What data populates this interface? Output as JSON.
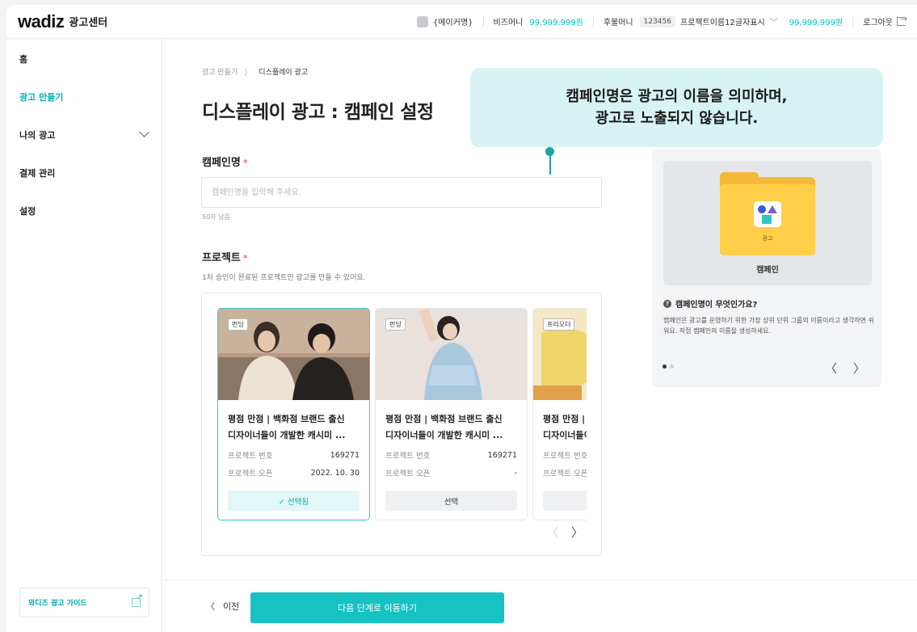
{
  "header": {
    "logo": "wadiz",
    "logo_sub": "광고센터",
    "maker_name": "{메이커명}",
    "biz_money_label": "비즈머니",
    "biz_money_value": "99,999,999원",
    "postpaid_label": "후불머니",
    "project_code": "123456",
    "project_name": "프로젝트이름12글자표시",
    "postpaid_value": "99,999,999원",
    "logout_label": "로그아웃"
  },
  "sidebar": {
    "items": [
      {
        "label": "홈"
      },
      {
        "label": "광고 만들기"
      },
      {
        "label": "나의 광고"
      },
      {
        "label": "결제 관리"
      },
      {
        "label": "설정"
      }
    ],
    "guide_label": "와디즈 광고 가이드"
  },
  "breadcrumb": {
    "parent": "광고 만들기",
    "current": "디스플레이 광고"
  },
  "page_title": "디스플레이 광고 : 캠페인 설정",
  "campaign_name": {
    "label": "캠페인명",
    "required_mark": "*",
    "placeholder": "캠페인명을 입력해 주세요.",
    "chars_left": "50자 남음"
  },
  "project": {
    "label": "프로젝트",
    "required_mark": "*",
    "description": "1차 승인이 완료된 프로젝트만 광고를 만들 수 있어요.",
    "number_label": "프로젝트 번호",
    "open_label": "프로젝트 오픈",
    "cards": [
      {
        "tag": "펀딩",
        "title_line1": "평점 만점 | 백화점 브랜드 출신",
        "title_line2": "디자이너들이 개발한 캐시미 ...",
        "number": "169271",
        "open": "2022. 10. 30",
        "button": "✓ 선택됨",
        "selected": true
      },
      {
        "tag": "펀딩",
        "title_line1": "평점 만점 | 백화점 브랜드 출신",
        "title_line2": "디자이너들이 개발한 캐시미 ...",
        "number": "169271",
        "open": "-",
        "button": "선택",
        "selected": false
      },
      {
        "tag": "프리오더",
        "title_line1": "평점 만점 | 백화점 브랜드 출신",
        "title_line2": "디자이너들이 개발한 캐시미 ...",
        "number": "",
        "open": "",
        "button": "",
        "selected": false
      }
    ]
  },
  "tooltip": {
    "line1": "캠페인명은 광고의 이름을 의미하며,",
    "line2": "광고로 노출되지 않습니다."
  },
  "tip_panel": {
    "folder_label": "광고",
    "image_caption": "캠페인",
    "question": "캠페인명이 무엇인가요?",
    "description": "캠페인은 광고를 운영하기 위한 가장 상위 단위 그룹의 이름이라고 생각하면 쉬워요. 직접 캠페인의 이름을 생성하세요."
  },
  "footer": {
    "prev_label": "이전",
    "next_label": "다음 단계로 이동하기"
  },
  "colors": {
    "accent": "#16c2c2",
    "money": "#00c4c4",
    "tooltip_bg": "#d8f3f3",
    "required": "#ff6a6a"
  }
}
